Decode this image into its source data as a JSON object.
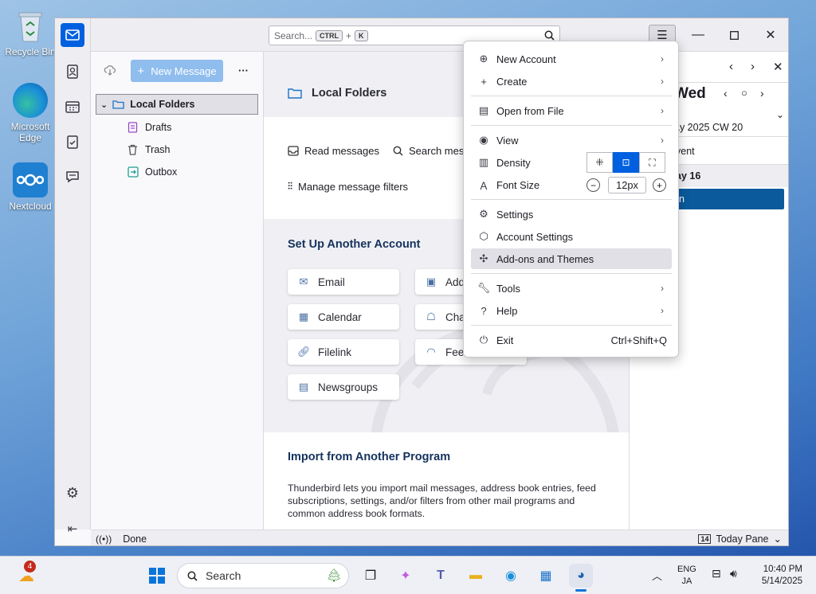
{
  "desktop": {
    "icons": [
      {
        "label": "Recycle Bin"
      },
      {
        "label": "Microsoft Edge"
      },
      {
        "label": "Nextcloud"
      }
    ]
  },
  "titlebar": {
    "search_placeholder": "Search...",
    "shortcut_mod": "CTRL",
    "shortcut_plus": "+",
    "shortcut_key": "K"
  },
  "folder_pane": {
    "new_message": "New Message",
    "more": "···",
    "root": "Local Folders",
    "folders": [
      {
        "label": "Drafts"
      },
      {
        "label": "Trash"
      },
      {
        "label": "Outbox"
      }
    ]
  },
  "main": {
    "header_title": "Local Folders",
    "actions": {
      "read": "Read messages",
      "search": "Search messages",
      "filters": "Manage message filters"
    },
    "setup_heading": "Set Up Another Account",
    "setup_buttons": [
      {
        "label": "Email"
      },
      {
        "label": "Address Book"
      },
      {
        "label": "Calendar"
      },
      {
        "label": "Chat"
      },
      {
        "label": "Filelink"
      },
      {
        "label": "Feeds"
      },
      {
        "label": "Newsgroups"
      }
    ],
    "import_heading": "Import from Another Program",
    "import_text": "Thunderbird lets you import mail messages, address book entries, feed subscriptions, settings, and/or filters from other mail programs and common address book formats."
  },
  "today_pane": {
    "day": "Wed",
    "date_line": "ay 2025  CW 20",
    "event_col": "vent",
    "day_row": "ay 16",
    "event_bar": "n"
  },
  "app_menu": {
    "items": [
      {
        "label": "New Account"
      },
      {
        "label": "Create"
      },
      {
        "label": "Open from File"
      },
      {
        "label": "View"
      },
      {
        "label": "Density"
      },
      {
        "label": "Font Size"
      },
      {
        "label": "Settings"
      },
      {
        "label": "Account Settings"
      },
      {
        "label": "Add-ons and Themes"
      },
      {
        "label": "Tools"
      },
      {
        "label": "Help"
      },
      {
        "label": "Exit"
      }
    ],
    "font_size_value": "12px",
    "exit_shortcut": "Ctrl+Shift+Q"
  },
  "statusbar": {
    "status": "Done",
    "today_pane_label": "Today Pane",
    "today_pane_day": "14"
  },
  "taskbar": {
    "weather_badge": "4",
    "search_label": "Search",
    "lang_top": "ENG",
    "lang_bottom": "JA",
    "time": "10:40 PM",
    "date": "5/14/2025"
  },
  "colors": {
    "accent": "#0060df",
    "heading": "#15325d",
    "new_message_bg": "#8fbdee",
    "event_bar": "#0a5a9c"
  }
}
